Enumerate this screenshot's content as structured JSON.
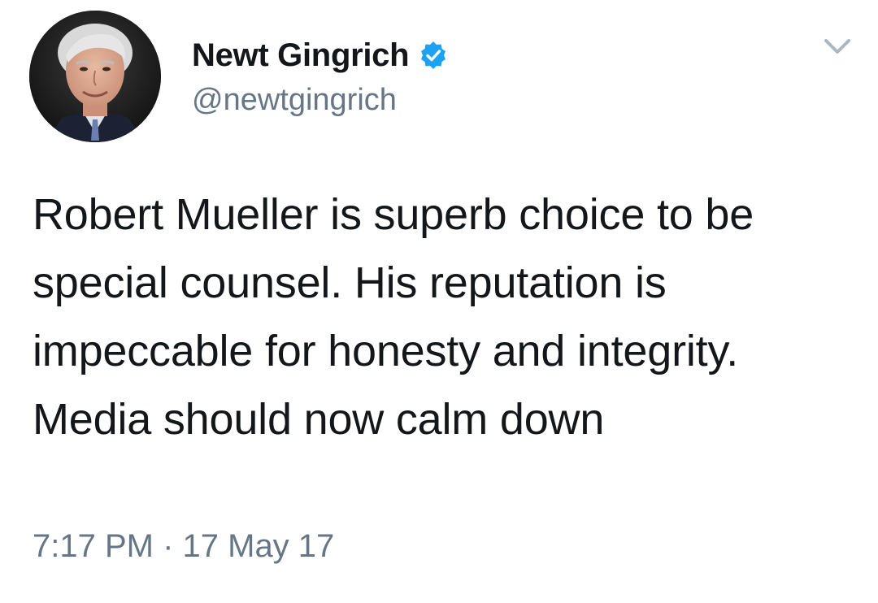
{
  "tweet": {
    "display_name": "Newt Gingrich",
    "handle": "@newtgingrich",
    "text": "Robert Mueller is superb choice to be special counsel. His reputation is impeccable for honesty and integrity. Media should now calm down",
    "timestamp": "7:17 PM · 17 May 17",
    "verified_icon": "verified-badge-icon",
    "menu_icon": "chevron-down-icon"
  },
  "colors": {
    "text_primary": "#14171a",
    "text_secondary": "#657786",
    "verified_blue": "#1da1f2",
    "caret_gray": "#aab8c2"
  }
}
